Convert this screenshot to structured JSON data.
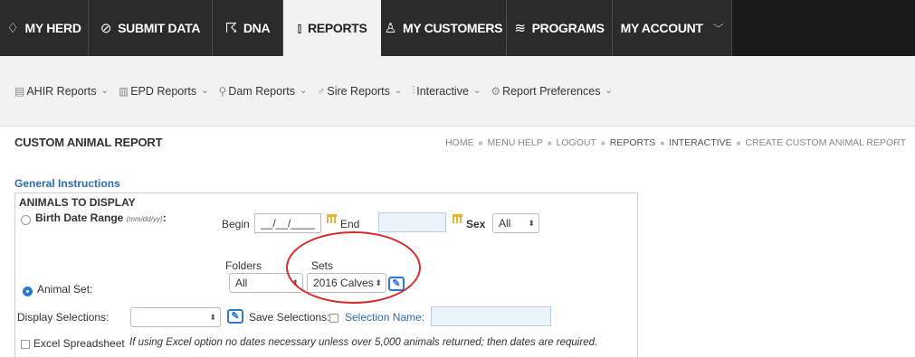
{
  "topnav": {
    "tabs": [
      {
        "label": "MY HERD",
        "icon": "tag-icon"
      },
      {
        "label": "SUBMIT DATA",
        "icon": "upload-icon"
      },
      {
        "label": "DNA",
        "icon": "dna-icon"
      },
      {
        "label": "REPORTS",
        "icon": "bar-chart-icon"
      },
      {
        "label": "MY CUSTOMERS",
        "icon": "users-icon"
      },
      {
        "label": "PROGRAMS",
        "icon": "layers-icon"
      },
      {
        "label": "MY ACCOUNT",
        "icon": "chevron-down-icon"
      }
    ],
    "active_tab": "REPORTS"
  },
  "subnav": {
    "items": [
      {
        "label": "AHIR Reports"
      },
      {
        "label": "EPD Reports"
      },
      {
        "label": "Dam Reports"
      },
      {
        "label": "Sire Reports"
      },
      {
        "label": "Interactive"
      },
      {
        "label": "Report Preferences"
      }
    ]
  },
  "page": {
    "title": "CUSTOM ANIMAL REPORT",
    "breadcrumb": [
      "HOME",
      "MENU HELP",
      "LOGOUT",
      "REPORTS",
      "INTERACTIVE",
      "CREATE CUSTOM ANIMAL REPORT"
    ],
    "general_instructions": "General Instructions"
  },
  "form": {
    "section_title": "ANIMALS TO DISPLAY",
    "birth_date_label": "Birth Date Range",
    "birth_date_hint": "mm/dd/yy)",
    "birth_date_paren": "(",
    "birth_date_colon": ":",
    "begin_label": "Begin",
    "begin_value": "__/__/____",
    "end_label": "End",
    "end_value": "",
    "sex_label": "Sex",
    "sex_value": "All",
    "animal_set_label": "Animal Set:",
    "folders_label": "Folders",
    "folders_value": "All",
    "sets_label": "Sets",
    "sets_value": "2016 Calves",
    "display_selections_label": "Display Selections:",
    "display_selections_value": "",
    "save_selections_label": "Save Selections:",
    "selection_name_label": "Selection Name:",
    "selection_name_value": "",
    "excel_label": "Excel Spreadsheet",
    "excel_note": "If using Excel option no dates necessary unless over 5,000 animals returned; then dates are required."
  },
  "colors": {
    "nav_bg": "#1a1a1a",
    "link_blue": "#2b6db5",
    "highlight_circle": "#d52a2a",
    "calendar_icon": "#e6b42e"
  }
}
